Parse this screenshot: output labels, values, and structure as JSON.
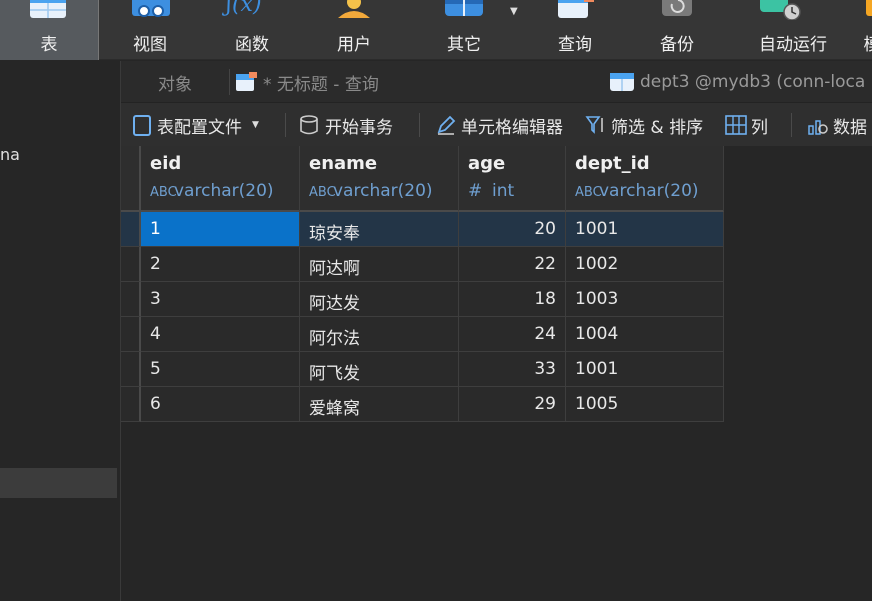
{
  "toolbar": {
    "items": [
      {
        "label": "表",
        "icon": "table-icon"
      },
      {
        "label": "视图",
        "icon": "view-icon"
      },
      {
        "label": "函数",
        "icon": "function-icon"
      },
      {
        "label": "用户",
        "icon": "user-icon"
      },
      {
        "label": "其它",
        "icon": "other-icon"
      },
      {
        "label": "查询",
        "icon": "query-icon"
      },
      {
        "label": "备份",
        "icon": "backup-icon"
      },
      {
        "label": "自动运行",
        "icon": "automation-icon"
      },
      {
        "label": "模",
        "icon": "model-icon"
      }
    ],
    "function_glyph": "ʃ(x)"
  },
  "sidebar": {
    "fragment_text": "na"
  },
  "tabs": [
    {
      "label": "对象"
    },
    {
      "label": "* 无标题 - 查询"
    },
    {
      "label": "dept3 @mydb3 (conn-loca"
    }
  ],
  "subtoolbar": {
    "table_config": "表配置文件",
    "begin_transaction": "开始事务",
    "cell_editor": "单元格编辑器",
    "filter_sort": "筛选 & 排序",
    "columns": "列",
    "data": "数据"
  },
  "grid": {
    "columns": [
      {
        "name": "eid",
        "type": "varchar(20)",
        "type_icon": "ABC"
      },
      {
        "name": "ename",
        "type": "varchar(20)",
        "type_icon": "ABC"
      },
      {
        "name": "age",
        "type": "int",
        "type_icon": "#"
      },
      {
        "name": "dept_id",
        "type": "varchar(20)",
        "type_icon": "ABC"
      }
    ],
    "rows": [
      [
        "1",
        "琼安奉",
        "20",
        "1001"
      ],
      [
        "2",
        "阿达啊",
        "22",
        "1002"
      ],
      [
        "3",
        "阿达发",
        "18",
        "1003"
      ],
      [
        "4",
        "阿尔法",
        "24",
        "1004"
      ],
      [
        "5",
        "阿飞发",
        "33",
        "1001"
      ],
      [
        "6",
        "爱蜂窝",
        "29",
        "1005"
      ]
    ],
    "selected_row": 0
  },
  "colors": {
    "accent": "#0a72c9",
    "selected_row": "#233547",
    "type_text": "#6f9fd0",
    "background": "#262626"
  }
}
